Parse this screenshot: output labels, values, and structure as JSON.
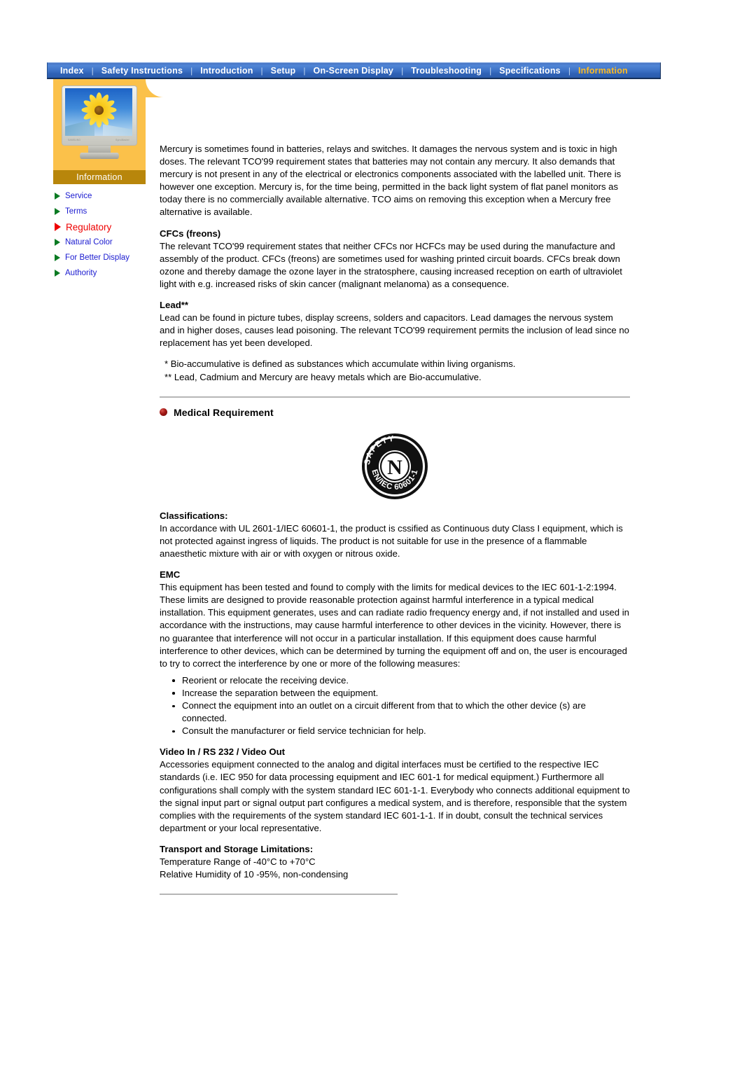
{
  "navbar": {
    "separator": "|",
    "items": [
      {
        "label": "Index",
        "active": false
      },
      {
        "label": "Safety Instructions",
        "active": false
      },
      {
        "label": "Introduction",
        "active": false
      },
      {
        "label": "Setup",
        "active": false
      },
      {
        "label": "On-Screen Display",
        "active": false
      },
      {
        "label": "Troubleshooting",
        "active": false
      },
      {
        "label": "Specifications",
        "active": false
      },
      {
        "label": "Information",
        "active": true
      }
    ]
  },
  "sidebar": {
    "banner_label": "Information",
    "monitor_brand_left": "SAMSUNG",
    "monitor_brand_right": "SyncMaster",
    "links": [
      {
        "label": "Service",
        "active": false
      },
      {
        "label": "Terms",
        "active": false
      },
      {
        "label": "Regulatory",
        "active": true
      },
      {
        "label": "Natural Color",
        "active": false
      },
      {
        "label": "For Better Display",
        "active": false
      },
      {
        "label": "Authority",
        "active": false
      }
    ]
  },
  "content": {
    "mercury_paragraph": "Mercury is sometimes found in batteries, relays and switches. It damages the nervous system and is toxic in high doses. The relevant TCO'99 requirement states that batteries may not contain any mercury. It also demands that mercury is not present in any of the electrical or electronics components associated with the labelled unit. There is however one exception. Mercury is, for the time being, permitted in the back light system of flat panel monitors as today there is no commercially available alternative. TCO aims on removing this exception when a Mercury free alternative is available.",
    "cfcs_heading": "CFCs (freons)",
    "cfcs_paragraph": "The relevant TCO'99 requirement states that neither CFCs nor HCFCs may be used during the manufacture and assembly of the product. CFCs (freons) are sometimes used for washing printed circuit boards. CFCs break down ozone and thereby damage the ozone layer in the stratosphere, causing increased reception on earth of ultraviolet light with e.g. increased risks of skin cancer (malignant melanoma) as a consequence.",
    "lead_heading": "Lead**",
    "lead_paragraph": "Lead can be found in picture tubes, display screens, solders and capacitors. Lead damages the nervous system and in higher doses, causes lead poisoning. The relevant TCO'99 requirement permits the inclusion of lead since no replacement has yet been developed.",
    "footnote_one": "* Bio-accumulative is defined as substances which accumulate within living organisms.",
    "footnote_two": "** Lead, Cadmium and Mercury are heavy metals which are Bio-accumulative.",
    "medical_requirement_title": "Medical Requirement",
    "safety_logo": {
      "top_arc_text": "SAFETY",
      "bottom_arc_text": "EN/IEC 60601-1",
      "center_letter": "N"
    },
    "classifications_heading": "Classifications:",
    "classifications_paragraph": "In accordance with UL 2601-1/IEC 60601-1, the product is cssified as Continuous duty Class I equipment, which is not protected against ingress of liquids. The product is not suitable for use in the presence of a flammable anaesthetic mixture with air or with oxygen or nitrous oxide.",
    "emc_heading": "EMC",
    "emc_paragraph": "This equipment has been tested and found to comply with the limits for medical devices to the IEC 601-1-2:1994. These limits are designed to provide reasonable protection against harmful interference in a typical medical installation. This equipment generates, uses and can radiate radio frequency energy and, if not installed and used in accordance with the instructions, may cause harmful interference to other devices in the vicinity. However, there is no guarantee that interference will not occur in a particular installation. If this equipment does cause harmful interference to other devices, which can be determined by turning the equipment off and on, the user is encouraged to try to correct the interference by one or more of the following measures:",
    "emc_measures": [
      "Reorient or relocate the receiving device.",
      "Increase the separation between the equipment.",
      "Connect the equipment into an outlet on a circuit different from that to which the other device (s) are connected.",
      "Consult the manufacturer or field service technician for help."
    ],
    "video_heading": "Video In / RS 232 / Video Out",
    "video_paragraph": "Accessories equipment connected to the analog and digital interfaces must be certified to the respective IEC standards (i.e. IEC 950 for data processing equipment and IEC 601-1 for medical equipment.) Furthermore all configurations shall comply with the system standard IEC 601-1-1. Everybody who connects additional equipment to the signal input part or signal output part configures a medical system, and is therefore, responsible that the system complies with the requirements of the system standard IEC 601-1-1. If in doubt, consult the technical services department or your local representative.",
    "transport_heading": "Transport and Storage Limitations:",
    "transport_line_one": "Temperature Range of -40°C to +70°C",
    "transport_line_two": "Relative Humidity of 10 -95%, non-condensing"
  },
  "colors": {
    "nav_blue": "#3f74c8",
    "nav_active_gold": "#ffbb22",
    "sidebar_orange": "#fbc14a",
    "banner_goldenrod": "#b8860b",
    "link_blue": "#1a1ad0",
    "link_active_red": "#ee0000",
    "arrow_green": "#0a7a22",
    "bullet_dark_red": "#a01714"
  }
}
